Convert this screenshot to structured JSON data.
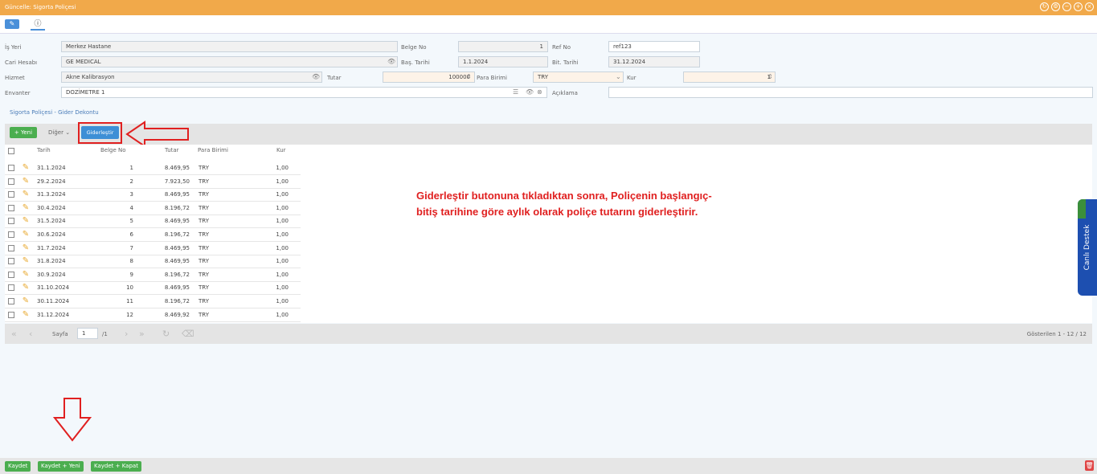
{
  "window": {
    "title": "Güncelle: Sigorta Poliçesi"
  },
  "form": {
    "is_yeri_label": "İş Yeri",
    "is_yeri_value": "Merkez Hastane",
    "belge_no_label": "Belge No",
    "belge_no_value": "1",
    "ref_no_label": "Ref No",
    "ref_no_value": "ref123",
    "cari_label": "Cari Hesabı",
    "cari_value": "GE MEDICAL",
    "bas_tarihi_label": "Baş. Tarihi",
    "bas_tarihi_value": "1.1.2024",
    "bit_tarihi_label": "Bit. Tarihi",
    "bit_tarihi_value": "31.12.2024",
    "hizmet_label": "Hizmet",
    "hizmet_value": "Akne Kalibrasyon",
    "tutar_label": "Tutar",
    "tutar_value": "100000",
    "para_birimi_label": "Para Birimi",
    "para_birimi_value": "TRY",
    "kur_label": "Kur",
    "kur_value": "1",
    "envanter_label": "Envanter",
    "envanter_value": "DOZİMETRE 1",
    "aciklama_label": "Açıklama",
    "aciklama_value": ""
  },
  "section_link": "Sigorta Poliçesi - Gider Dekontu",
  "toolbar": {
    "yeni": "Yeni",
    "diger": "Diğer",
    "giderlestir": "Giderleştir"
  },
  "grid": {
    "headers": [
      "Tarih",
      "Belge No",
      "Tutar",
      "Para Birimi",
      "Kur"
    ],
    "rows": [
      [
        "31.1.2024",
        "1",
        "8.469,95",
        "TRY",
        "1,00"
      ],
      [
        "29.2.2024",
        "2",
        "7.923,50",
        "TRY",
        "1,00"
      ],
      [
        "31.3.2024",
        "3",
        "8.469,95",
        "TRY",
        "1,00"
      ],
      [
        "30.4.2024",
        "4",
        "8.196,72",
        "TRY",
        "1,00"
      ],
      [
        "31.5.2024",
        "5",
        "8.469,95",
        "TRY",
        "1,00"
      ],
      [
        "30.6.2024",
        "6",
        "8.196,72",
        "TRY",
        "1,00"
      ],
      [
        "31.7.2024",
        "7",
        "8.469,95",
        "TRY",
        "1,00"
      ],
      [
        "31.8.2024",
        "8",
        "8.469,95",
        "TRY",
        "1,00"
      ],
      [
        "30.9.2024",
        "9",
        "8.196,72",
        "TRY",
        "1,00"
      ],
      [
        "31.10.2024",
        "10",
        "8.469,95",
        "TRY",
        "1,00"
      ],
      [
        "30.11.2024",
        "11",
        "8.196,72",
        "TRY",
        "1,00"
      ],
      [
        "31.12.2024",
        "12",
        "8.469,92",
        "TRY",
        "1,00"
      ]
    ]
  },
  "pager": {
    "sayfa_label": "Sayfa",
    "page": "1",
    "of": "/1",
    "shown": "Gösterilen 1 - 12 / 12"
  },
  "annotation": "Giderleştir butonuna tıkladıktan sonra, Poliçenin başlangıç-bitiş tarihine göre aylık olarak poliçe tutarını giderleştirir.",
  "footer": {
    "kaydet": "Kaydet",
    "kaydet_yeni": "Kaydet + Yeni",
    "kaydet_kapat": "Kaydet + Kapat"
  },
  "side_tab": "Canlı Destek",
  "colors": {
    "title_bar": "#f1a94a",
    "primary_button": "#3d8fd6",
    "success_button": "#4bae4f",
    "annotation_red": "#e02020"
  }
}
